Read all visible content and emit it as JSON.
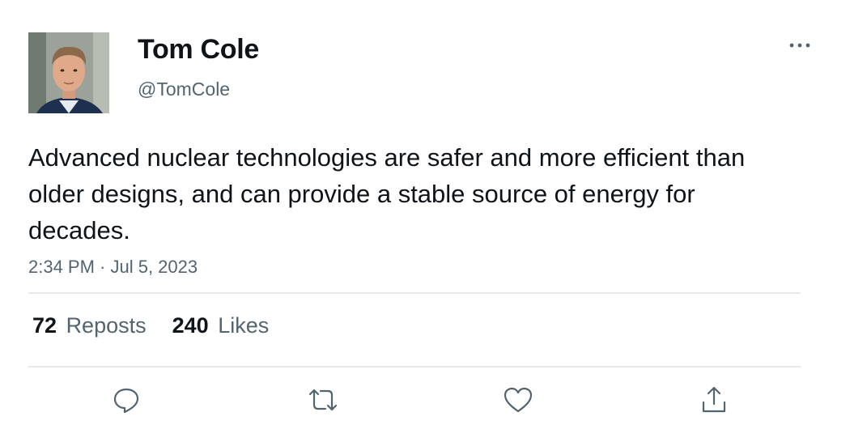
{
  "author": {
    "display_name": "Tom Cole",
    "handle": "@TomCole",
    "avatar_icon": "avatar-photo"
  },
  "tweet": {
    "text": "Advanced nuclear technologies are safer and more efficient than older designs, and can provide a stable source of energy for decades.",
    "timestamp": "2:34 PM · Jul 5, 2023"
  },
  "stats": {
    "reposts_count": "72",
    "reposts_label": "Reposts",
    "likes_count": "240",
    "likes_label": "Likes"
  },
  "actions": {
    "reply_icon": "reply-icon",
    "repost_icon": "repost-icon",
    "like_icon": "heart-icon",
    "share_icon": "share-icon"
  },
  "colors": {
    "text_primary": "#0f1419",
    "text_secondary": "#536471",
    "divider": "#e6e8ea"
  }
}
